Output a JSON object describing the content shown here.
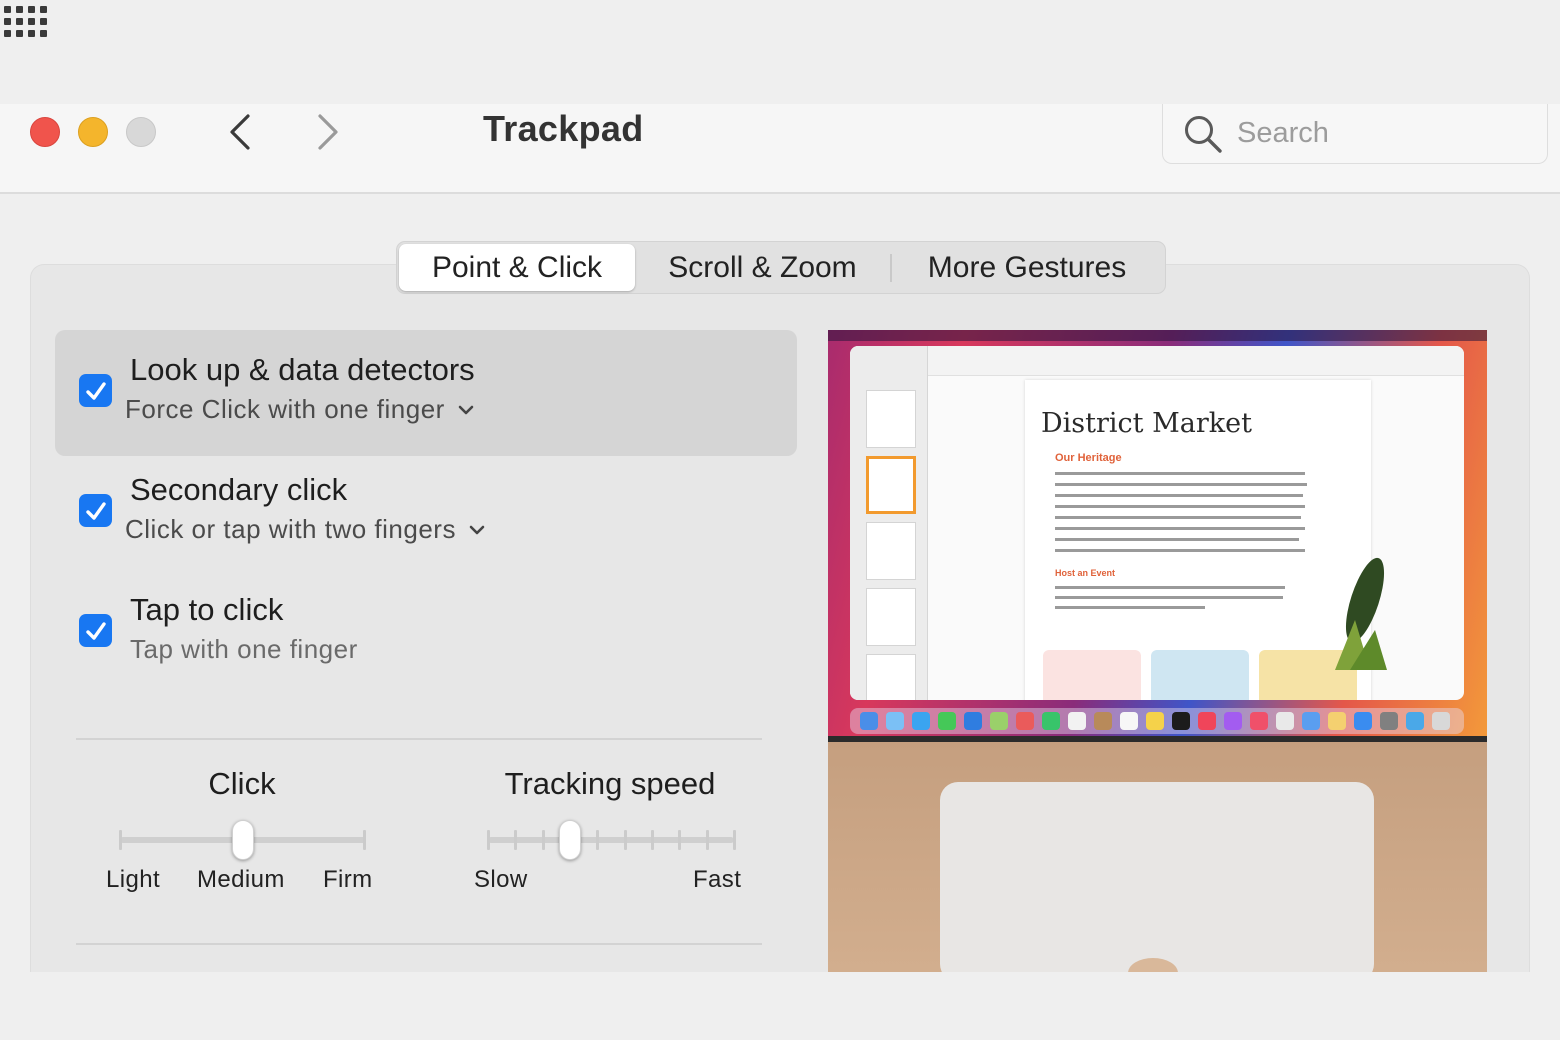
{
  "window": {
    "title": "Trackpad"
  },
  "search": {
    "placeholder": "Search"
  },
  "tabs": [
    {
      "label": "Point & Click",
      "selected": true
    },
    {
      "label": "Scroll & Zoom",
      "selected": false
    },
    {
      "label": "More Gestures",
      "selected": false
    }
  ],
  "options": [
    {
      "title": "Look up & data detectors",
      "subtitle": "Force Click with one finger",
      "checked": true,
      "has_dropdown": true,
      "highlighted": true
    },
    {
      "title": "Secondary click",
      "subtitle": "Click or tap with two fingers",
      "checked": true,
      "has_dropdown": true,
      "highlighted": false
    },
    {
      "title": "Tap to click",
      "subtitle": "Tap with one finger",
      "checked": true,
      "has_dropdown": false,
      "highlighted": false
    }
  ],
  "sliders": {
    "click": {
      "title": "Click",
      "labels": [
        "Light",
        "Medium",
        "Firm"
      ],
      "value": "Medium",
      "value_fraction": 0.5
    },
    "tracking": {
      "title": "Tracking speed",
      "min_label": "Slow",
      "max_label": "Fast",
      "steps": 10,
      "value_step": 3
    }
  },
  "preview": {
    "doc_title": "District Market",
    "section_1": "Our Heritage",
    "section_2": "Host an Event"
  },
  "colors": {
    "accent": "#1877f2",
    "close": "#f0544c",
    "minimize": "#f4b52c",
    "zoom_disabled": "#d8d8d8"
  },
  "icons": {
    "back": "chevron-left-icon",
    "forward": "chevron-right-icon",
    "grid": "grid-icon",
    "search": "magnifier-icon",
    "dropdown": "chevron-down-icon",
    "checkbox": "checkmark-icon"
  }
}
